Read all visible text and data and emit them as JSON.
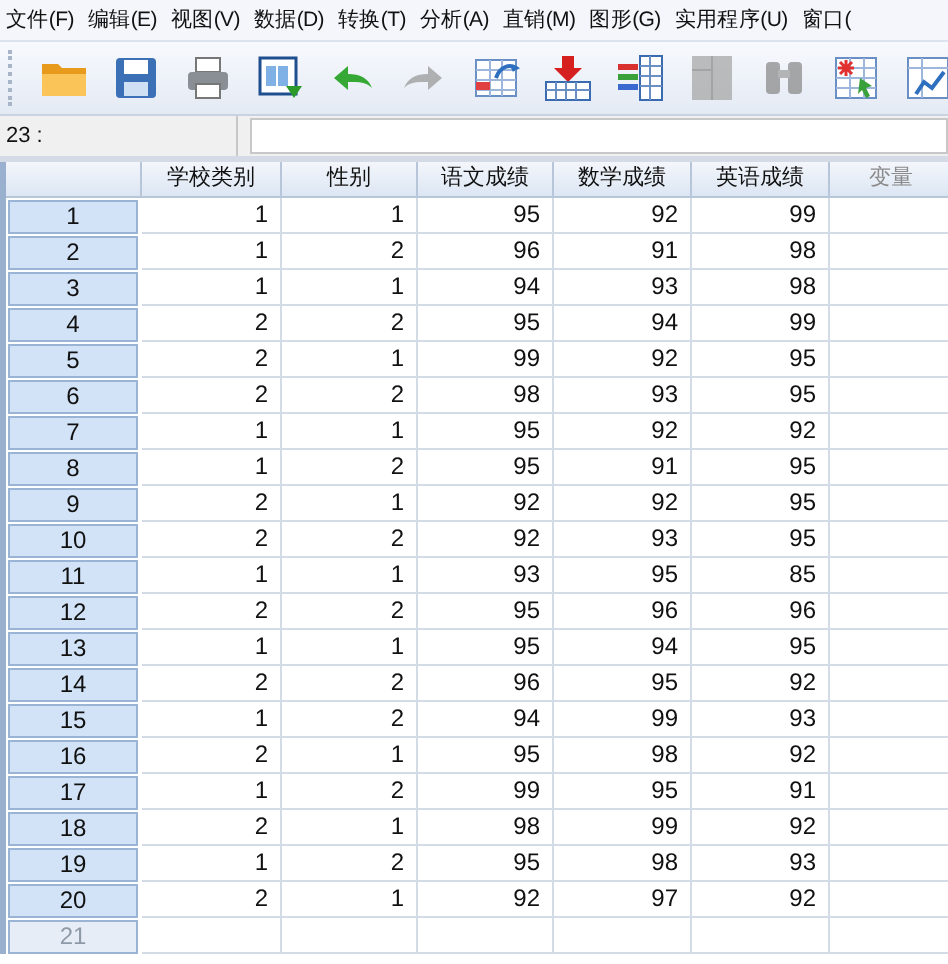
{
  "menu": [
    "文件(F)",
    "编辑(E)",
    "视图(V)",
    "数据(D)",
    "转换(T)",
    "分析(A)",
    "直销(M)",
    "图形(G)",
    "实用程序(U)",
    "窗口("
  ],
  "toolbar": [
    {
      "kind": "open",
      "disabled": false
    },
    {
      "kind": "save",
      "disabled": false
    },
    {
      "kind": "print",
      "disabled": false
    },
    {
      "kind": "recall",
      "disabled": false
    },
    {
      "kind": "undo",
      "disabled": false
    },
    {
      "kind": "redo",
      "disabled": true
    },
    {
      "kind": "goto",
      "disabled": false
    },
    {
      "kind": "insert",
      "disabled": false
    },
    {
      "kind": "variables",
      "disabled": false
    },
    {
      "kind": "split",
      "disabled": true
    },
    {
      "kind": "find",
      "disabled": true
    },
    {
      "kind": "labels",
      "disabled": false
    },
    {
      "kind": "chart",
      "disabled": false
    }
  ],
  "cell_bar": {
    "reference": "23 :"
  },
  "table": {
    "columns": [
      {
        "label": "学校类别",
        "disabled": false
      },
      {
        "label": "性别",
        "disabled": false
      },
      {
        "label": "语文成绩",
        "disabled": false
      },
      {
        "label": "数学成绩",
        "disabled": false
      },
      {
        "label": "英语成绩",
        "disabled": false
      },
      {
        "label": "变量",
        "disabled": true
      }
    ],
    "rows": [
      {
        "number": "1",
        "disabled": false,
        "cells": [
          "1",
          "1",
          "95",
          "92",
          "99"
        ]
      },
      {
        "number": "2",
        "disabled": false,
        "cells": [
          "1",
          "2",
          "96",
          "91",
          "98"
        ]
      },
      {
        "number": "3",
        "disabled": false,
        "cells": [
          "1",
          "1",
          "94",
          "93",
          "98"
        ]
      },
      {
        "number": "4",
        "disabled": false,
        "cells": [
          "2",
          "2",
          "95",
          "94",
          "99"
        ]
      },
      {
        "number": "5",
        "disabled": false,
        "cells": [
          "2",
          "1",
          "99",
          "92",
          "95"
        ]
      },
      {
        "number": "6",
        "disabled": false,
        "cells": [
          "2",
          "2",
          "98",
          "93",
          "95"
        ]
      },
      {
        "number": "7",
        "disabled": false,
        "cells": [
          "1",
          "1",
          "95",
          "92",
          "92"
        ]
      },
      {
        "number": "8",
        "disabled": false,
        "cells": [
          "1",
          "2",
          "95",
          "91",
          "95"
        ]
      },
      {
        "number": "9",
        "disabled": false,
        "cells": [
          "2",
          "1",
          "92",
          "92",
          "95"
        ]
      },
      {
        "number": "10",
        "disabled": false,
        "cells": [
          "2",
          "2",
          "92",
          "93",
          "95"
        ]
      },
      {
        "number": "11",
        "disabled": false,
        "cells": [
          "1",
          "1",
          "93",
          "95",
          "85"
        ]
      },
      {
        "number": "12",
        "disabled": false,
        "cells": [
          "2",
          "2",
          "95",
          "96",
          "96"
        ]
      },
      {
        "number": "13",
        "disabled": false,
        "cells": [
          "1",
          "1",
          "95",
          "94",
          "95"
        ]
      },
      {
        "number": "14",
        "disabled": false,
        "cells": [
          "2",
          "2",
          "96",
          "95",
          "92"
        ]
      },
      {
        "number": "15",
        "disabled": false,
        "cells": [
          "1",
          "2",
          "94",
          "99",
          "93"
        ]
      },
      {
        "number": "16",
        "disabled": false,
        "cells": [
          "2",
          "1",
          "95",
          "98",
          "92"
        ]
      },
      {
        "number": "17",
        "disabled": false,
        "cells": [
          "1",
          "2",
          "99",
          "95",
          "91"
        ]
      },
      {
        "number": "18",
        "disabled": false,
        "cells": [
          "2",
          "1",
          "98",
          "99",
          "92"
        ]
      },
      {
        "number": "19",
        "disabled": false,
        "cells": [
          "1",
          "2",
          "95",
          "98",
          "93"
        ]
      },
      {
        "number": "20",
        "disabled": false,
        "cells": [
          "2",
          "1",
          "92",
          "97",
          "92"
        ]
      },
      {
        "number": "21",
        "disabled": true
      }
    ]
  }
}
